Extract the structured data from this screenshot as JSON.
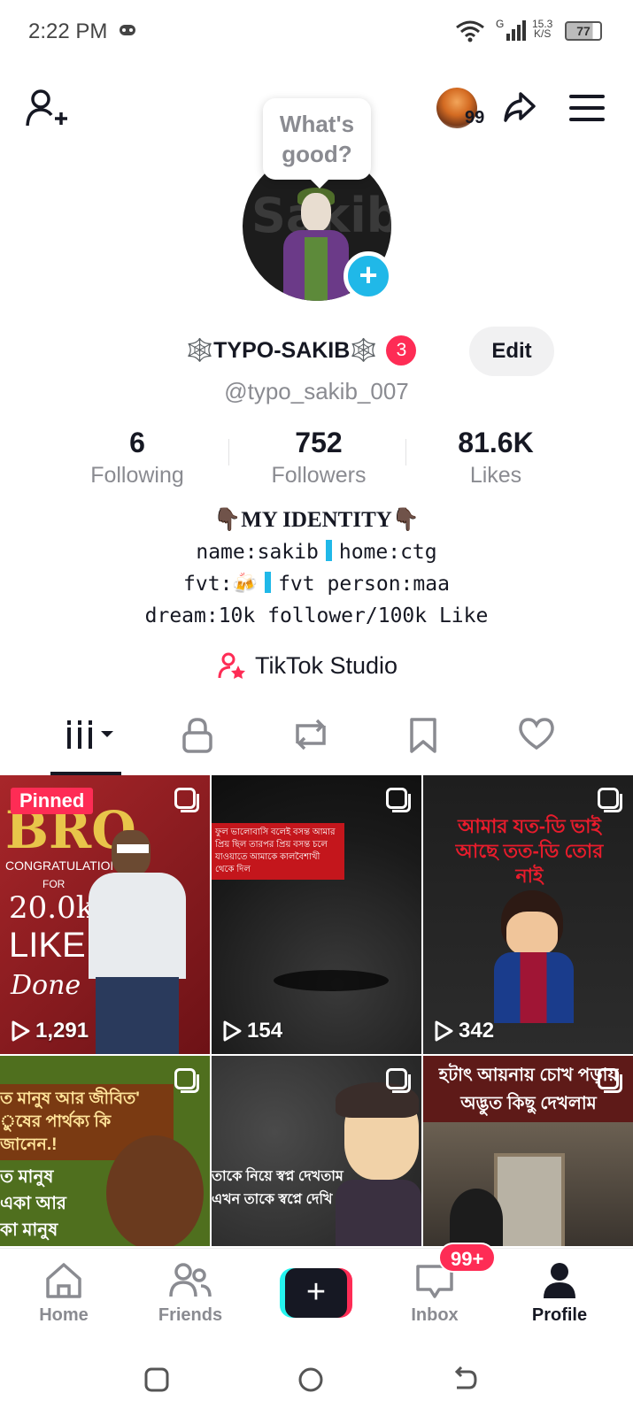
{
  "status_bar": {
    "time": "2:22 PM",
    "network_type": "G",
    "speed_value": "15.3",
    "speed_unit": "K/S",
    "battery": "77"
  },
  "header": {
    "notification_count": "99"
  },
  "bubble": {
    "text": "What's good?"
  },
  "profile": {
    "display_name": "🕸️TYPO-SAKIB🕸️",
    "badge_count": "3",
    "edit_label": "Edit",
    "handle": "@typo_sakib_007"
  },
  "stats": [
    {
      "value": "6",
      "label": "Following"
    },
    {
      "value": "752",
      "label": "Followers"
    },
    {
      "value": "81.6K",
      "label": "Likes"
    }
  ],
  "bio": {
    "line1": "👇🏿MY IDENTITY👇🏿",
    "line2_a": "name:sakib",
    "line2_b": "home:ctg",
    "line3_a": "fvt:🍻",
    "line3_b": "fvt person:maa",
    "line4": "dream:10k follower/100k Like"
  },
  "studio": {
    "label": "TikTok Studio"
  },
  "videos": [
    {
      "views": "1,291",
      "pinned_label": "Pinned",
      "caption_big": "BRO",
      "caption_small": "CONGRATULATION",
      "caption_for": "FOR",
      "caption_num": "20.0k",
      "caption_like": "LIKE",
      "caption_done": "Done"
    },
    {
      "views": "154",
      "caption": "ফুল ভালোবাসি বলেই বসন্ত আমার প্রিয় ছিল তারপর প্রিয় বসন্ত চলে যাওয়াতে আমাকে কালবৈশাখী থেকে দিল"
    },
    {
      "views": "342",
      "caption_top": "আমার যত-ডি ভাই আছে তত-ডি তোর নাই"
    },
    {
      "caption_top": "ত মানুষ আর জীবিত' ুষের পার্থক্য কি জানেন.!",
      "caption_mid": "ত মানুষ একা আর কা মানুষ মৃত"
    },
    {
      "caption": "তাকে নিয়ে স্বপ্ন দেখতাম এখন তাকে স্বপ্নে দেখি"
    },
    {
      "caption_top": "হটাৎ আয়নায় চোখ পড়ায় অদ্ভুত কিছু দেখলাম"
    }
  ],
  "bottom_nav": [
    {
      "label": "Home"
    },
    {
      "label": "Friends"
    },
    {
      "label": "Inbox"
    },
    {
      "label": "Profile"
    }
  ],
  "inbox_badge": "99+",
  "avatar": {
    "background_text": "Sakib"
  },
  "colors": {
    "accent_red": "#fe2c55",
    "accent_cyan": "#25f4ee",
    "plus_blue": "#20b8e8",
    "text": "#161823",
    "muted": "#8a8b91"
  }
}
